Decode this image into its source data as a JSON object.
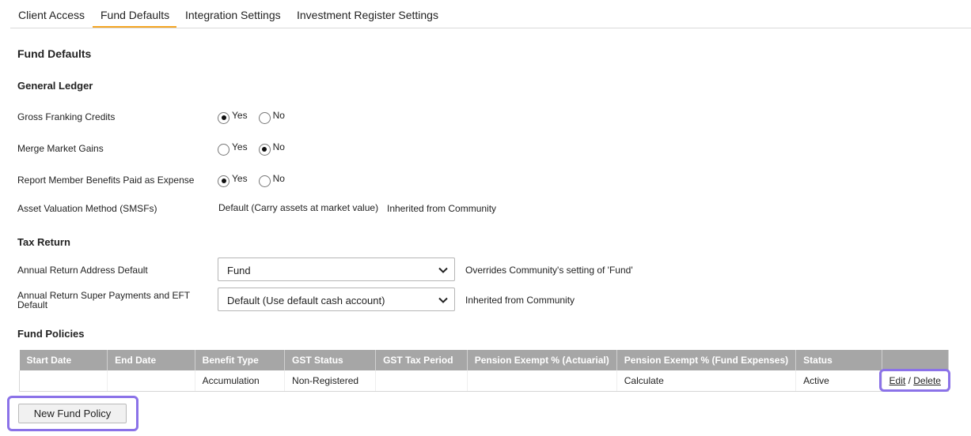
{
  "tabs": [
    "Client Access",
    "Fund Defaults",
    "Integration Settings",
    "Investment Register Settings"
  ],
  "active_tab": "Fund Defaults",
  "accent_color": "#f5a623",
  "highlight_color": "#8b72e8",
  "page_title": "Fund Defaults",
  "general_ledger": {
    "heading": "General Ledger",
    "gross_franking": {
      "label": "Gross Franking Credits",
      "yes": "Yes",
      "no": "No",
      "selected": "Yes"
    },
    "merge_market": {
      "label": "Merge Market Gains",
      "yes": "Yes",
      "no": "No",
      "selected": "No"
    },
    "report_member": {
      "label": "Report Member Benefits Paid as Expense",
      "yes": "Yes",
      "no": "No",
      "selected": "Yes"
    },
    "asset_valuation": {
      "label": "Asset Valuation Method (SMSFs)",
      "value": "Default (Carry assets at market value)",
      "note": "Inherited from Community"
    }
  },
  "tax_return": {
    "heading": "Tax Return",
    "address_default": {
      "label": "Annual Return Address Default",
      "value": "Fund",
      "note": "Overrides Community's setting of 'Fund'"
    },
    "super_payments": {
      "label": "Annual Return Super Payments and EFT Default",
      "value": "Default (Use default cash account)",
      "note": "Inherited from Community"
    }
  },
  "fund_policies": {
    "heading": "Fund Policies",
    "columns": [
      "Start Date",
      "End Date",
      "Benefit Type",
      "GST Status",
      "GST Tax Period",
      "Pension Exempt % (Actuarial)",
      "Pension Exempt % (Fund Expenses)",
      "Status",
      ""
    ],
    "rows": [
      {
        "start_date": "",
        "end_date": "",
        "benefit_type": "Accumulation",
        "gst_status": "Non-Registered",
        "gst_tax_period": "",
        "pension_actuarial": "",
        "pension_fund_expenses": "Calculate",
        "status": "Active",
        "edit": "Edit",
        "separator": "/",
        "delete": "Delete"
      }
    ],
    "new_button": "New Fund Policy"
  }
}
